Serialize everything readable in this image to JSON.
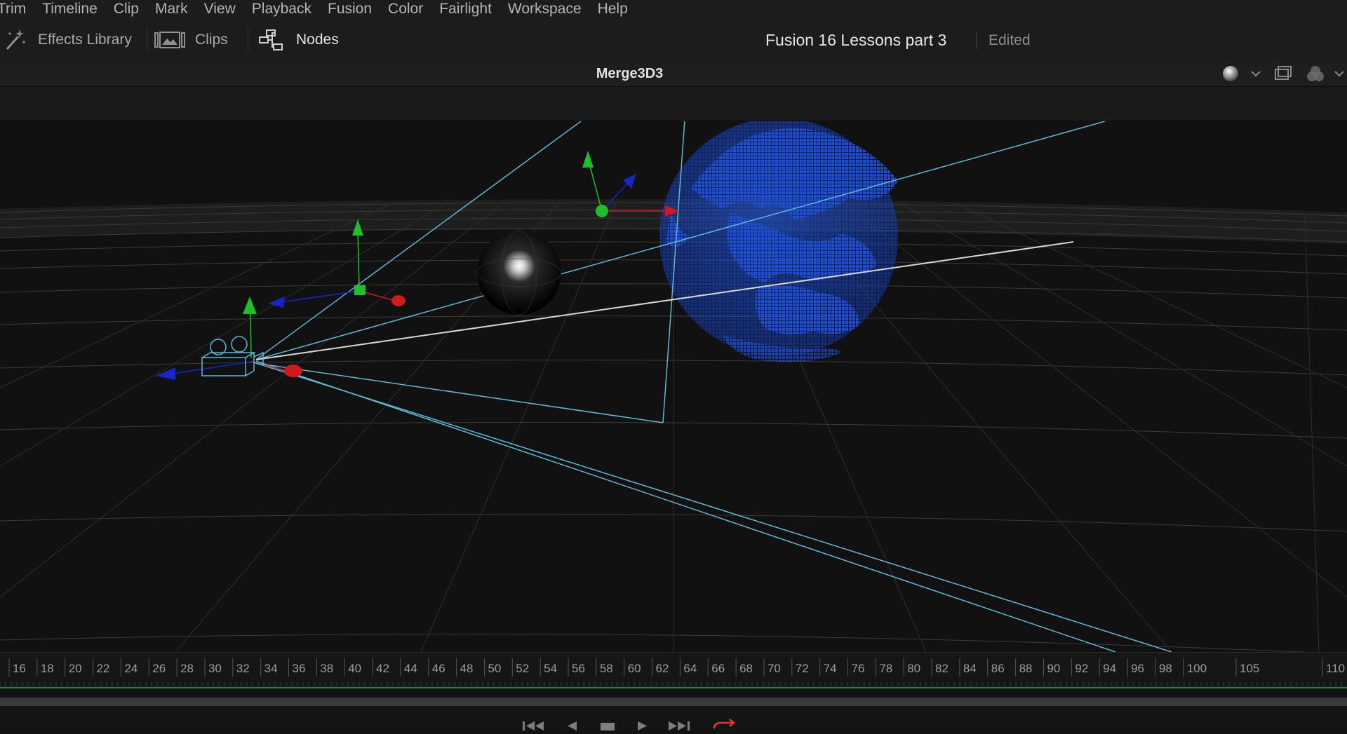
{
  "menu": [
    "Trim",
    "Timeline",
    "Clip",
    "Mark",
    "View",
    "Playback",
    "Fusion",
    "Color",
    "Fairlight",
    "Workspace",
    "Help"
  ],
  "toolbar": {
    "effects_library": "Effects Library",
    "clips": "Clips",
    "nodes": "Nodes"
  },
  "project": {
    "title": "Fusion 16 Lessons part 3",
    "status": "Edited"
  },
  "viewer": {
    "title": "Merge3D3"
  },
  "ruler": {
    "ticks": [
      "16",
      "18",
      "20",
      "22",
      "24",
      "26",
      "28",
      "30",
      "32",
      "34",
      "36",
      "38",
      "40",
      "42",
      "44",
      "46",
      "48",
      "50",
      "52",
      "54",
      "56",
      "58",
      "60",
      "62",
      "64",
      "66",
      "68",
      "70",
      "72",
      "74",
      "76",
      "78",
      "80",
      "82",
      "84",
      "86",
      "88",
      "90",
      "92",
      "94",
      "96",
      "98",
      "100",
      "105",
      "110"
    ]
  },
  "colors": {
    "x_axis": "#d01b1b",
    "y_axis": "#1fbf2a",
    "z_axis": "#1526c8",
    "globe": "#1d4fd8",
    "camera_lines": "#5fb9d6",
    "loop_active": "#e0392b"
  },
  "icons": {
    "effects": "magic-wand-icon",
    "clips": "filmstrip-icon",
    "nodes": "node-graph-icon"
  }
}
